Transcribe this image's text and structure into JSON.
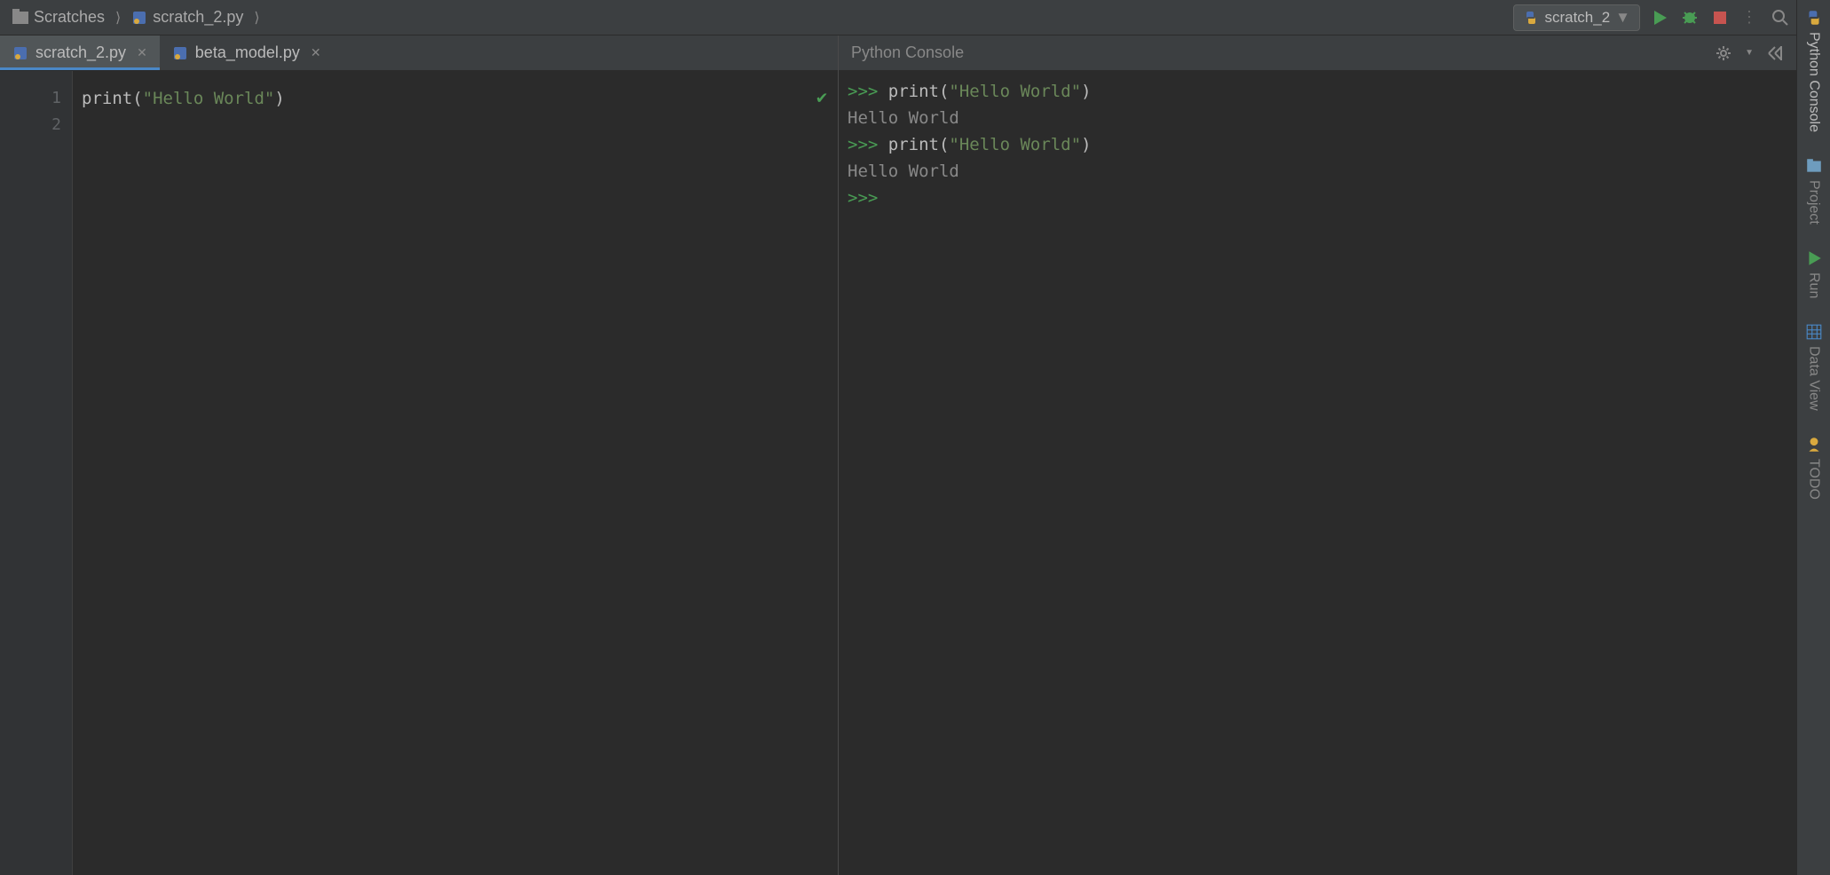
{
  "breadcrumbs": {
    "root": "Scratches",
    "file": "scratch_2.py"
  },
  "runConfig": {
    "selected": "scratch_2"
  },
  "tabs": [
    {
      "label": "scratch_2.py",
      "active": true
    },
    {
      "label": "beta_model.py",
      "active": false
    }
  ],
  "editor": {
    "gutter": [
      "1",
      "2"
    ],
    "code": {
      "func": "print",
      "open": "(",
      "arg": "\"Hello World\"",
      "close": ")"
    }
  },
  "console": {
    "title": "Python Console",
    "lines": [
      {
        "prompt": ">>> ",
        "func": "print",
        "open": "(",
        "arg": "\"Hello World\"",
        "close": ")"
      },
      {
        "output": "Hello World"
      },
      {
        "prompt": ">>> ",
        "func": "print",
        "open": "(",
        "arg": "\"Hello World\"",
        "close": ")"
      },
      {
        "output": "Hello World"
      },
      {
        "blank": " "
      },
      {
        "prompt": ">>> "
      }
    ]
  },
  "rightBar": {
    "pythonConsole": "Python Console",
    "project": "Project",
    "run": "Run",
    "dataView": "Data View",
    "todo": "TODO"
  }
}
